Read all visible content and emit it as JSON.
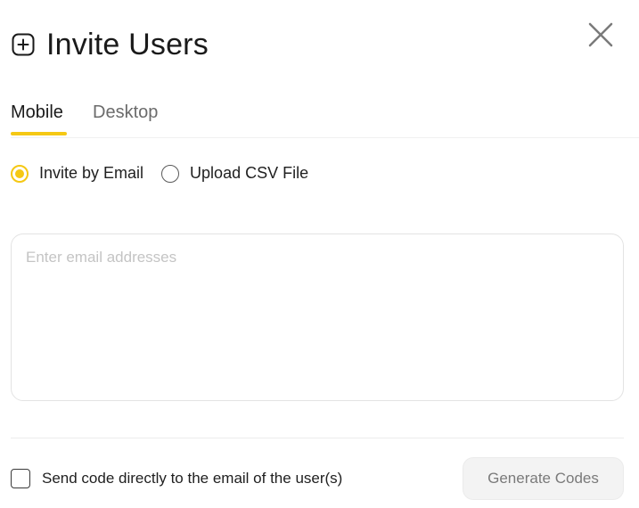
{
  "dialog": {
    "title": "Invite Users",
    "title_icon": "plus-square-icon",
    "close_icon": "close-icon"
  },
  "tabs": [
    {
      "label": "Mobile",
      "active": true
    },
    {
      "label": "Desktop",
      "active": false
    }
  ],
  "invite_method": {
    "options": [
      {
        "label": "Invite by Email",
        "selected": true
      },
      {
        "label": "Upload CSV File",
        "selected": false
      }
    ]
  },
  "email_input": {
    "value": "",
    "placeholder": "Enter email addresses"
  },
  "footer": {
    "send_direct_label": "Send code directly to the email of the user(s)",
    "send_direct_checked": false,
    "generate_label": "Generate Codes"
  },
  "colors": {
    "accent": "#f5c814",
    "text": "#1f1f1f",
    "muted_text": "#6b6b6b",
    "button_bg": "#f3f3f3"
  }
}
